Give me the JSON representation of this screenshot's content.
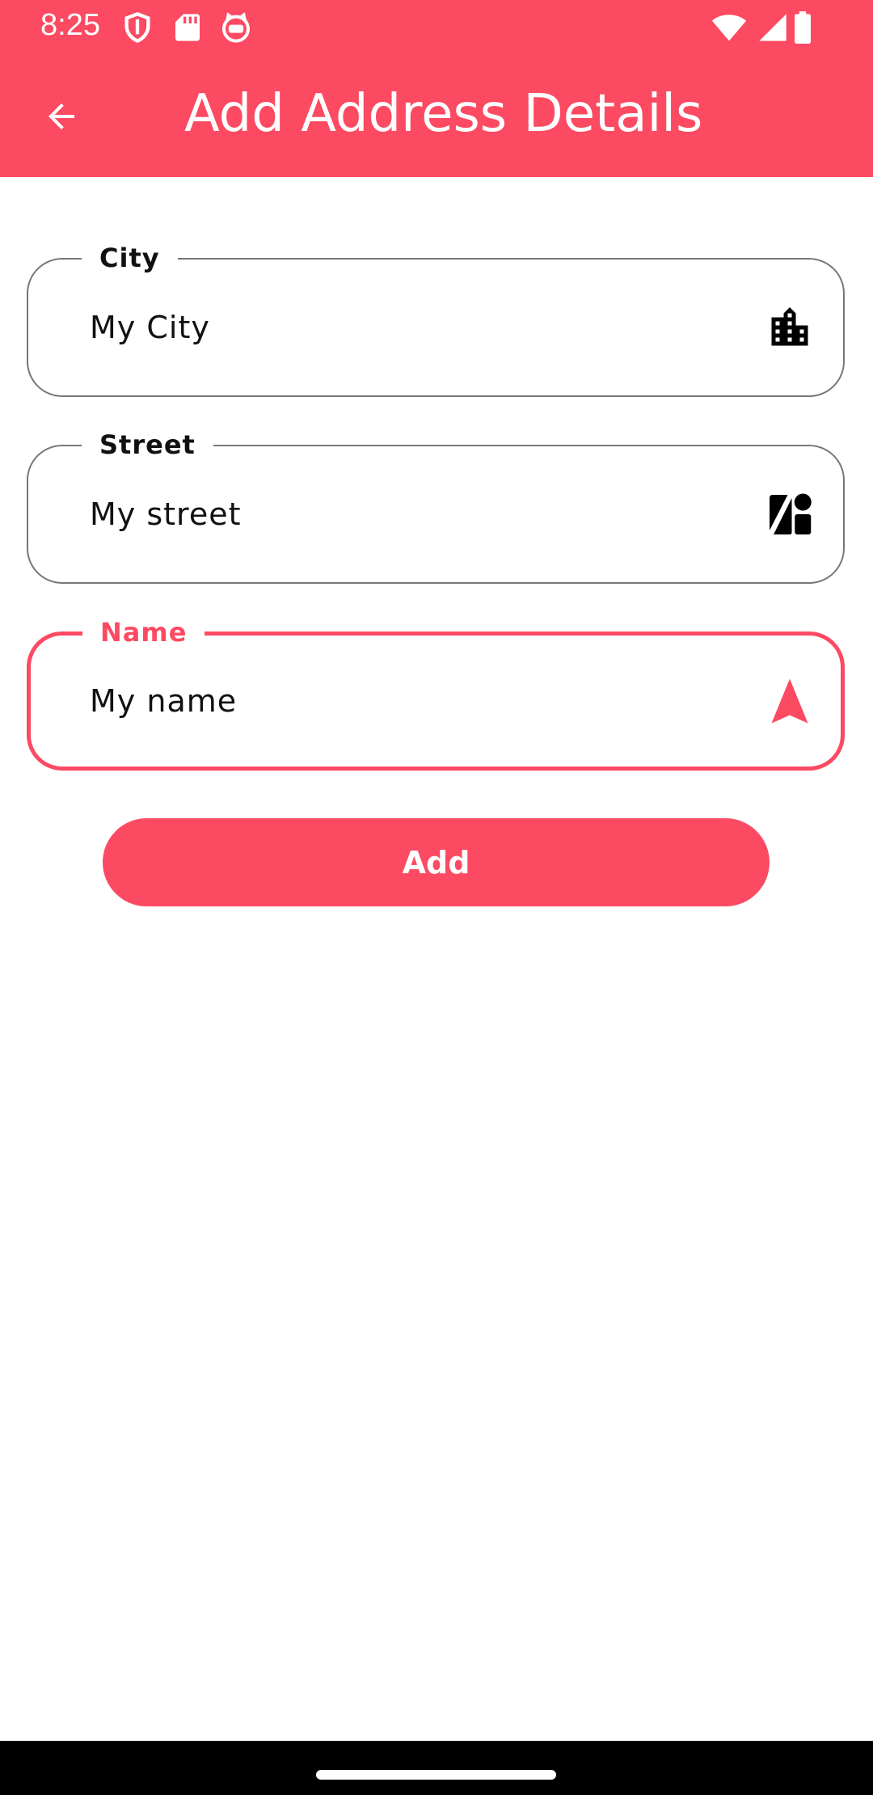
{
  "status_bar": {
    "time": "8:25",
    "icons": [
      "shield-icon",
      "sd-card-icon",
      "cat-icon"
    ],
    "right_icons": [
      "wifi-icon",
      "signal-icon",
      "battery-icon"
    ]
  },
  "app_bar": {
    "back_icon": "arrow-back-icon",
    "title": "Add Address Details"
  },
  "form": {
    "city": {
      "label": "City",
      "value": "My City",
      "icon": "city-buildings-icon"
    },
    "street": {
      "label": "Street",
      "value": "My street",
      "icon": "map-shapes-icon"
    },
    "name": {
      "label": "Name",
      "value": "My name",
      "icon": "navigation-arrow-icon",
      "focused": true
    }
  },
  "add_button": {
    "label": "Add"
  },
  "colors": {
    "accent": "#fc4a62",
    "outline": "#777777",
    "text": "#111111"
  }
}
